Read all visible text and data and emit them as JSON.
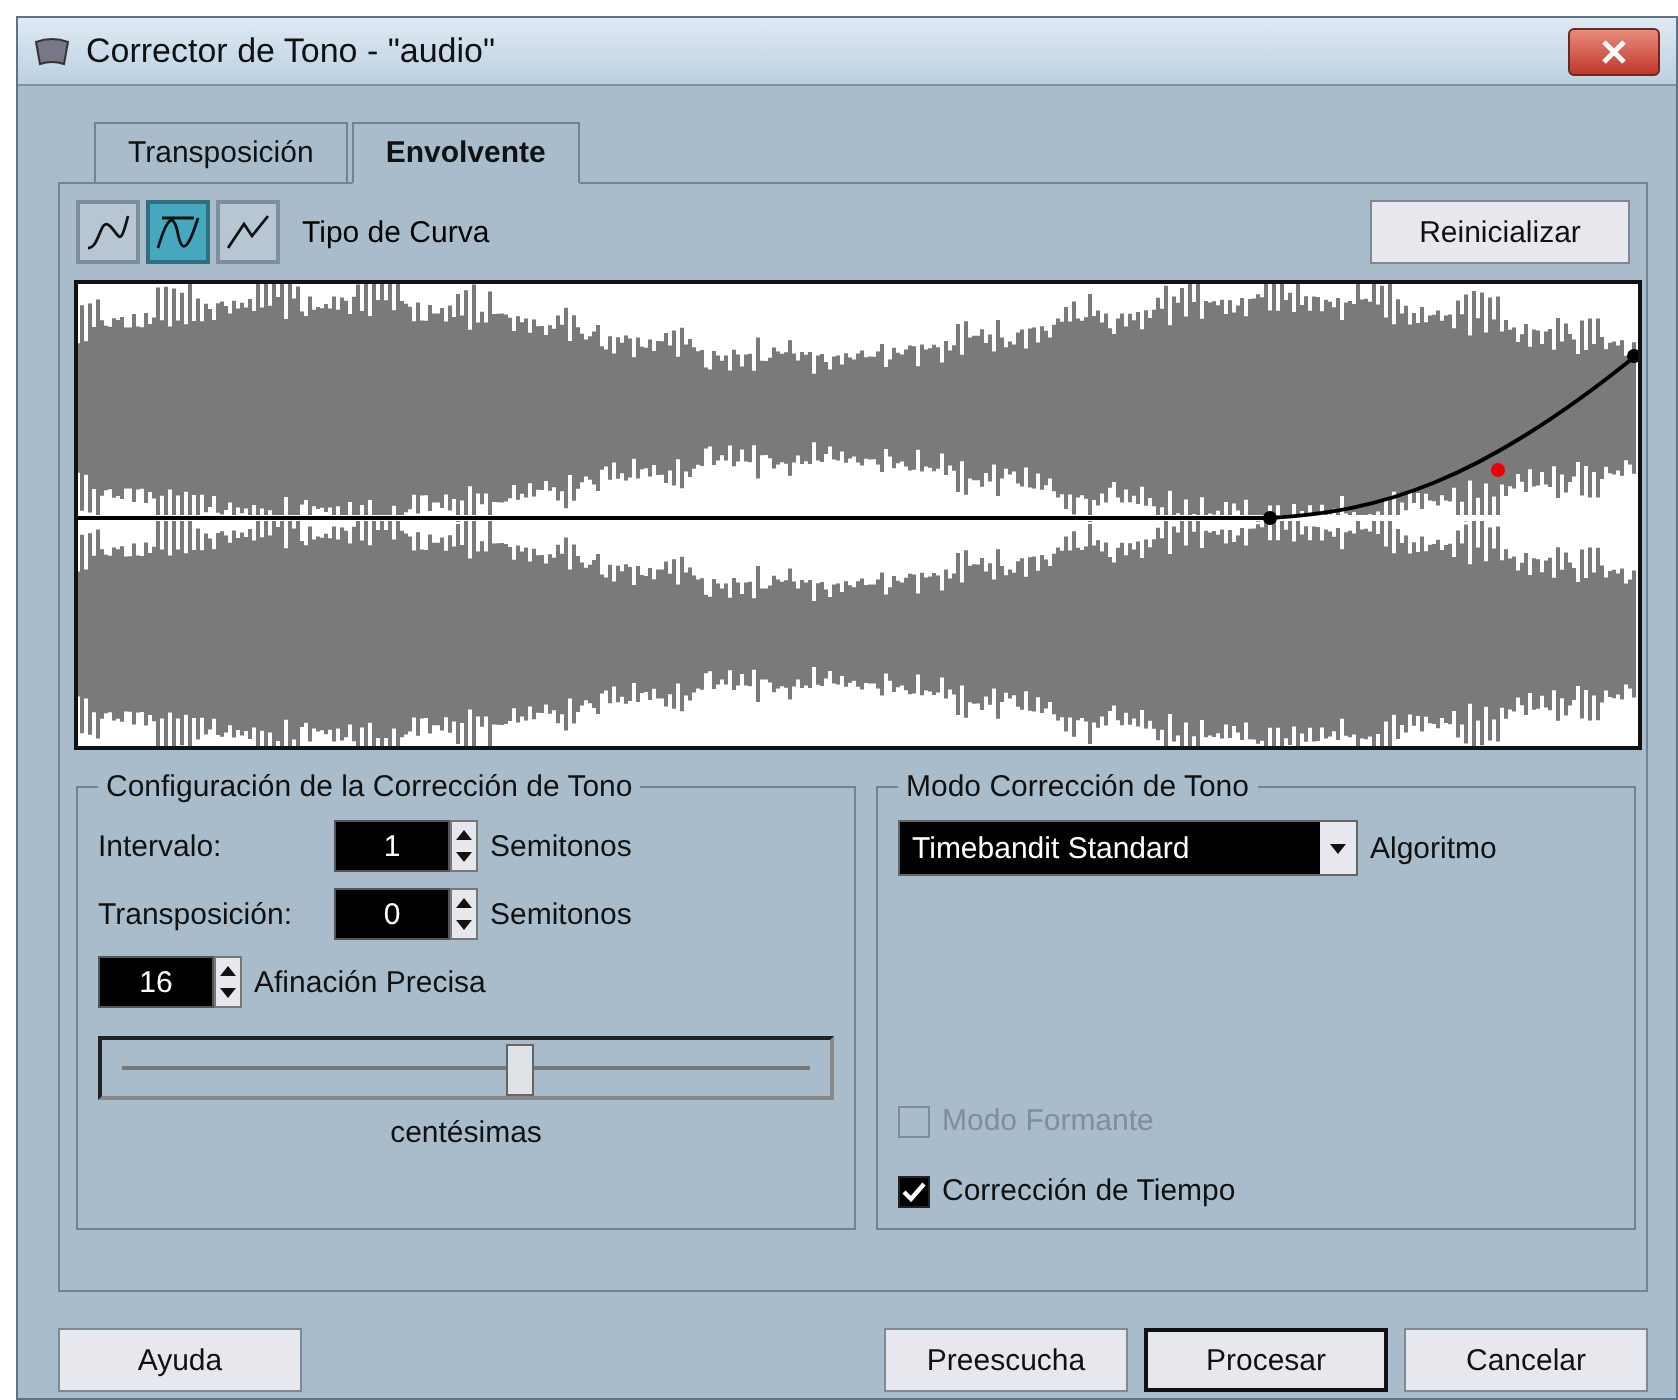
{
  "window": {
    "title": "Corrector de Tono - \"audio\""
  },
  "tabs": [
    {
      "label": "Transposición",
      "selected": false
    },
    {
      "label": "Envolvente",
      "selected": true
    }
  ],
  "curve_types": {
    "label": "Tipo de Curva",
    "buttons": [
      {
        "kind": "spline",
        "selected": false
      },
      {
        "kind": "damped",
        "selected": true
      },
      {
        "kind": "linear",
        "selected": false
      }
    ]
  },
  "reset_button": "Reinicializar",
  "pitch_settings": {
    "title": "Configuración de la Corrección de Tono",
    "fields": [
      {
        "label": "Intervalo:",
        "value": "1",
        "unit": "Semitonos"
      },
      {
        "label": "Transposición:",
        "value": "0",
        "unit": "Semitonos"
      }
    ],
    "fine_tune": {
      "value": "16",
      "label": "Afinación Precisa"
    },
    "slider": {
      "level": 0.575,
      "caption": "centésimas"
    }
  },
  "mode": {
    "title": "Modo Corrección de Tono",
    "algorithm": {
      "value": "Timebandit Standard",
      "label": "Algoritmo"
    },
    "options": [
      {
        "label": "Modo Formante",
        "checked": false,
        "disabled": true
      },
      {
        "label": "Corrección de Tiempo",
        "checked": true,
        "disabled": false
      }
    ]
  },
  "buttons": [
    {
      "label": "Ayuda",
      "default": false
    },
    {
      "label": "Preescucha",
      "default": false
    },
    {
      "label": "Procesar",
      "default": true
    },
    {
      "label": "Cancelar",
      "default": false
    }
  ]
}
